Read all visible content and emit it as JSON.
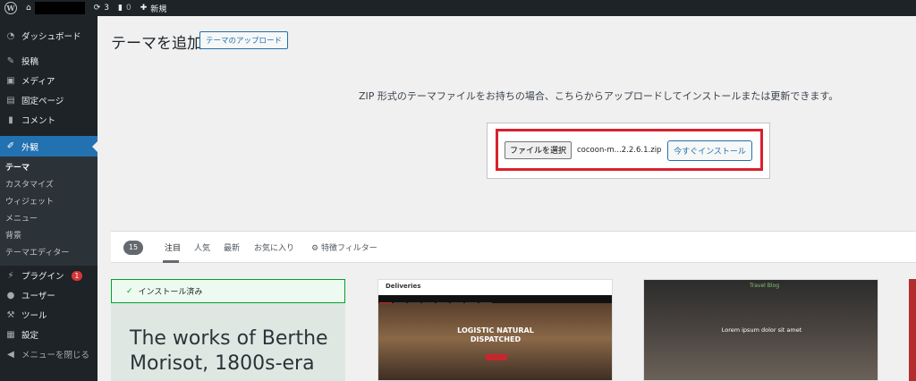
{
  "adminbar": {
    "updates_count": "3",
    "comments_count": "0",
    "new_label": "新規"
  },
  "sidebar": {
    "items": [
      {
        "icon": "dashboard-icon",
        "label": "ダッシュボード"
      },
      {
        "icon": "pin-icon",
        "label": "投稿"
      },
      {
        "icon": "media-icon",
        "label": "メディア"
      },
      {
        "icon": "page-icon",
        "label": "固定ページ"
      },
      {
        "icon": "comment-icon",
        "label": "コメント"
      }
    ],
    "active": {
      "icon": "brush-icon",
      "label": "外観"
    },
    "submenu": [
      "テーマ",
      "カスタマイズ",
      "ウィジェット",
      "メニュー",
      "背景",
      "テーマエディター"
    ],
    "lower_items": [
      {
        "icon": "plugin-icon",
        "label": "プラグイン",
        "badge": "1"
      },
      {
        "icon": "user-icon",
        "label": "ユーザー"
      },
      {
        "icon": "wrench-icon",
        "label": "ツール"
      },
      {
        "icon": "settings-icon",
        "label": "設定"
      }
    ],
    "collapse_label": "メニューを閉じる"
  },
  "main": {
    "title": "テーマを追加",
    "upload_button": "テーマのアップロード",
    "upload_description": "ZIP 形式のテーマファイルをお持ちの場合、こちらからアップロードしてインストールまたは更新できます。",
    "choose_file_button": "ファイルを選択",
    "file_name": "cocoon-m...2.2.6.1.zip",
    "install_button": "今すぐインストール"
  },
  "filter": {
    "count": "15",
    "tabs": [
      "注目",
      "人気",
      "最新",
      "お気に入り"
    ],
    "feature_filter": "特徴フィルター"
  },
  "themes": {
    "card1_installed": "インストール済み",
    "card1_title": "The works of Berthe Morisot, 1800s-era",
    "card2_brand": "Deliveries",
    "card2_headline": "LOGISTIC NATURAL DISPATCHED",
    "card3_brand": "Travel Blog",
    "card3_headline": "Lorem ipsum dolor sit amet"
  },
  "colors": {
    "accent": "#2271b1",
    "admin_bg": "#1d2327",
    "highlight_border": "#d9202e",
    "installed_green": "#00a32a"
  }
}
